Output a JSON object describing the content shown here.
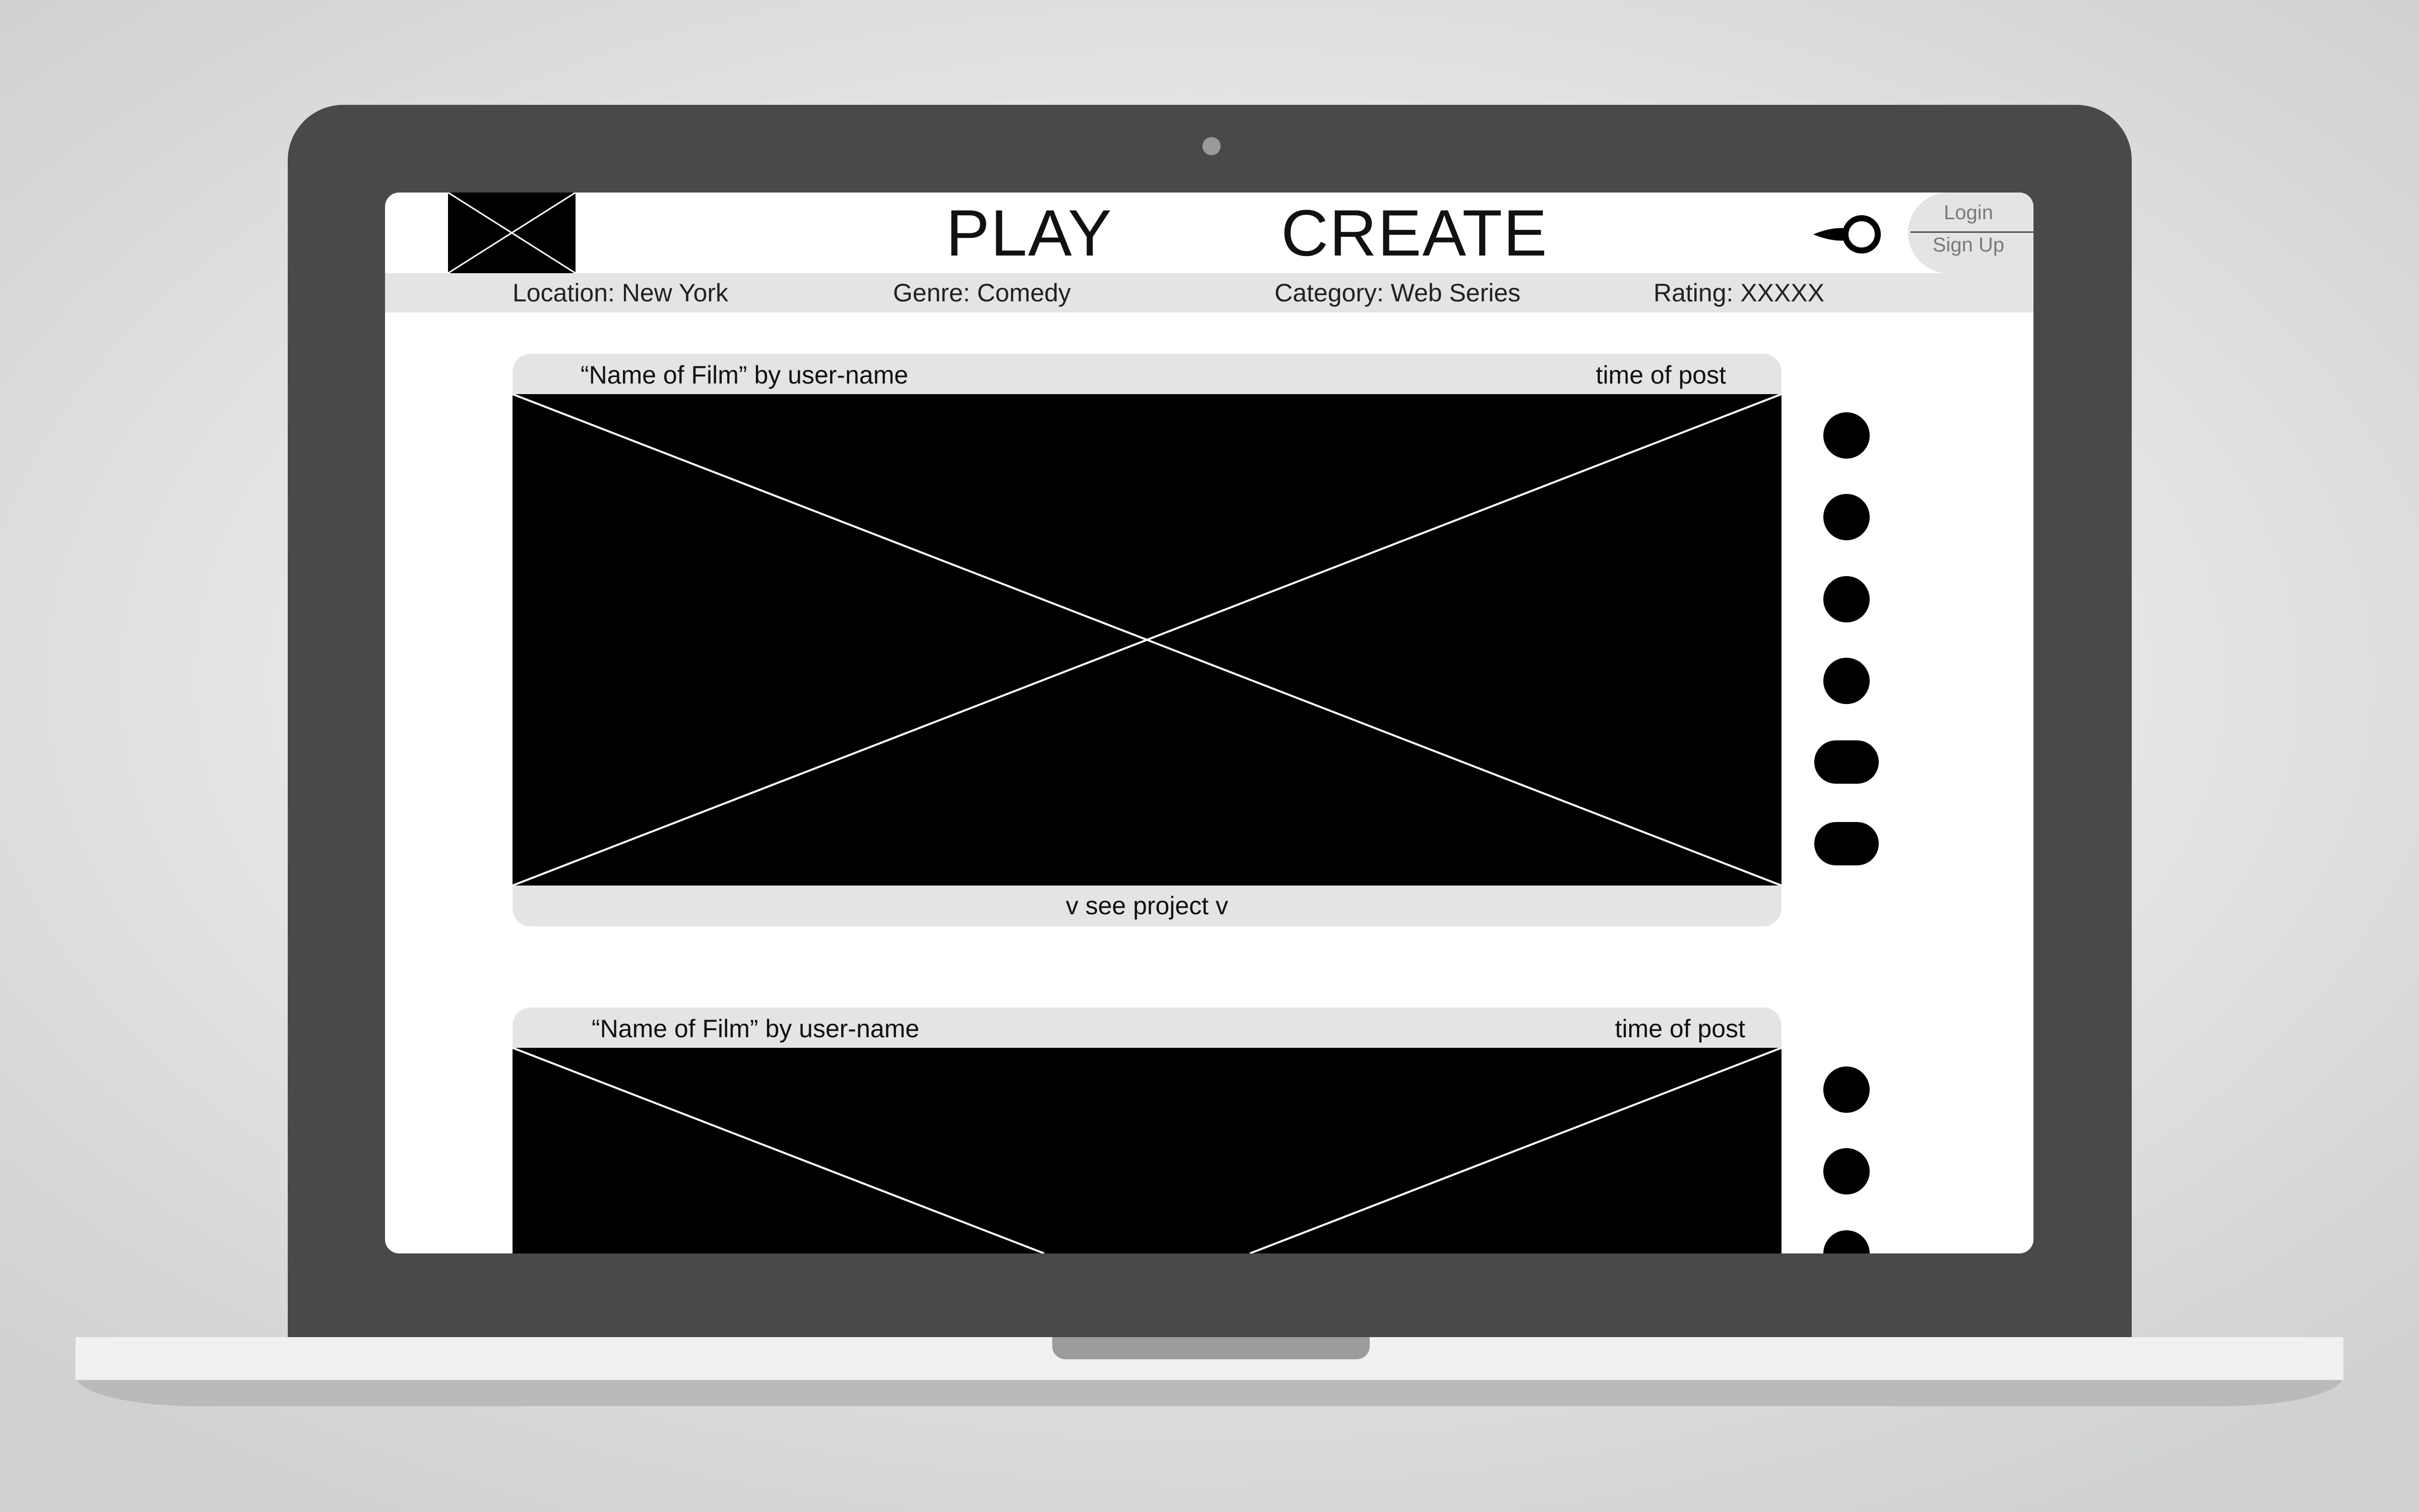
{
  "header": {
    "logo_icon": "image-placeholder-icon",
    "nav": {
      "play_label": "PLAY",
      "create_label": "CREATE"
    },
    "search_icon": "key-search-icon",
    "auth": {
      "login_label": "Login",
      "signup_label": "Sign Up"
    }
  },
  "filters": {
    "location": "Location: New York",
    "genre": "Genre: Comedy",
    "category": "Category: Web Series",
    "rating": "Rating: XXXXX"
  },
  "posts": [
    {
      "title": "“Name of Film” by user-name",
      "time": "time of post",
      "media_icon": "video-placeholder-icon",
      "footer_label": "v see project v",
      "actions": [
        "round-action-icon",
        "round-action-icon",
        "round-action-icon",
        "round-action-icon",
        "pill-action-icon",
        "pill-action-icon"
      ]
    },
    {
      "title": "“Name of Film” by user-name",
      "time": "time of post",
      "media_icon": "video-placeholder-icon",
      "actions": [
        "round-action-icon",
        "round-action-icon",
        "round-action-icon"
      ]
    }
  ],
  "colors": {
    "laptop_frame": "#494949",
    "screen_bg": "#ffffff",
    "bar_gray": "#e4e4e4",
    "media_black": "#000000"
  }
}
